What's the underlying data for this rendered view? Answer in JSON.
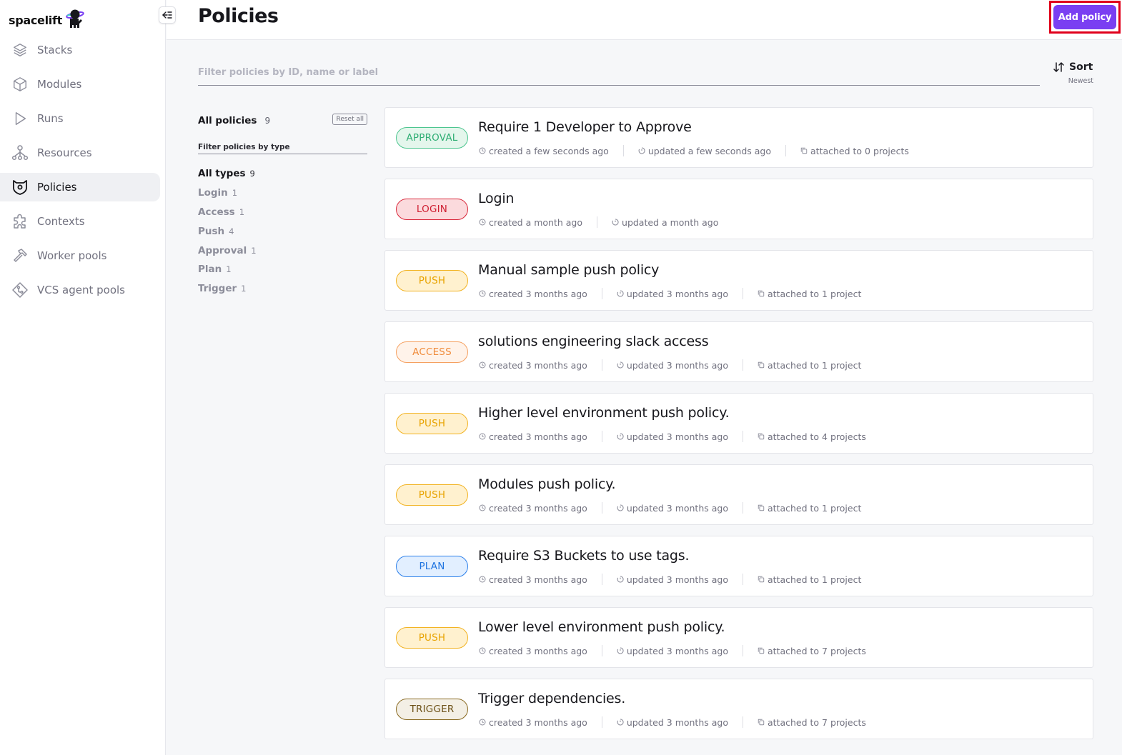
{
  "app": {
    "brand": "spacelift"
  },
  "sidebar": {
    "items": [
      {
        "label": "Stacks",
        "icon": "layers-icon",
        "active": false
      },
      {
        "label": "Modules",
        "icon": "cube-icon",
        "active": false
      },
      {
        "label": "Runs",
        "icon": "play-icon",
        "active": false
      },
      {
        "label": "Resources",
        "icon": "hierarchy-icon",
        "active": false
      },
      {
        "label": "Policies",
        "icon": "shield-devil-icon",
        "active": true
      },
      {
        "label": "Contexts",
        "icon": "puzzle-icon",
        "active": false
      },
      {
        "label": "Worker pools",
        "icon": "hammer-icon",
        "active": false
      },
      {
        "label": "VCS agent pools",
        "icon": "git-diamond-icon",
        "active": false
      }
    ]
  },
  "header": {
    "title": "Policies",
    "add_button": "Add policy"
  },
  "search": {
    "placeholder": "Filter policies by ID, name or label",
    "value": ""
  },
  "sort": {
    "label": "Sort",
    "value": "Newest"
  },
  "filters": {
    "all_policies_label": "All policies",
    "all_policies_count": "9",
    "reset_label": "Reset all",
    "type_header": "Filter policies by type",
    "types": [
      {
        "label": "All types",
        "count": "9",
        "active": true
      },
      {
        "label": "Login",
        "count": "1",
        "active": false
      },
      {
        "label": "Access",
        "count": "1",
        "active": false
      },
      {
        "label": "Push",
        "count": "4",
        "active": false
      },
      {
        "label": "Approval",
        "count": "1",
        "active": false
      },
      {
        "label": "Plan",
        "count": "1",
        "active": false
      },
      {
        "label": "Trigger",
        "count": "1",
        "active": false
      }
    ]
  },
  "badge_colors": {
    "APPROVAL": {
      "text": "#2fae74",
      "border": "#4cc58f",
      "bg": "#e4f6ec"
    },
    "LOGIN": {
      "text": "#cf1f32",
      "border": "#d9293c",
      "bg": "#fbdadd"
    },
    "PUSH": {
      "text": "#e8a300",
      "border": "#f2b322",
      "bg": "#fff1cf"
    },
    "ACCESS": {
      "text": "#f08c3c",
      "border": "#f5a060",
      "bg": "#fff3ea"
    },
    "PLAN": {
      "text": "#1f74e0",
      "border": "#2d80ea",
      "bg": "#e2efff"
    },
    "TRIGGER": {
      "text": "#6b5016",
      "border": "#8a6a22",
      "bg": "#f3efe5"
    }
  },
  "policies": [
    {
      "type": "APPROVAL",
      "name": "Require 1 Developer to Approve",
      "created": "created a few seconds ago",
      "updated": "updated a few seconds ago",
      "attached": "attached to 0 projects"
    },
    {
      "type": "LOGIN",
      "name": "Login",
      "created": "created a month ago",
      "updated": "updated a month ago",
      "attached": null
    },
    {
      "type": "PUSH",
      "name": "Manual sample push policy",
      "created": "created 3 months ago",
      "updated": "updated 3 months ago",
      "attached": "attached to 1 project"
    },
    {
      "type": "ACCESS",
      "name": "solutions engineering slack access",
      "created": "created 3 months ago",
      "updated": "updated 3 months ago",
      "attached": "attached to 1 project"
    },
    {
      "type": "PUSH",
      "name": "Higher level environment push policy.",
      "created": "created 3 months ago",
      "updated": "updated 3 months ago",
      "attached": "attached to 4 projects"
    },
    {
      "type": "PUSH",
      "name": "Modules push policy.",
      "created": "created 3 months ago",
      "updated": "updated 3 months ago",
      "attached": "attached to 1 project"
    },
    {
      "type": "PLAN",
      "name": "Require S3 Buckets to use tags.",
      "created": "created 3 months ago",
      "updated": "updated 3 months ago",
      "attached": "attached to 1 project"
    },
    {
      "type": "PUSH",
      "name": "Lower level environment push policy.",
      "created": "created 3 months ago",
      "updated": "updated 3 months ago",
      "attached": "attached to 7 projects"
    },
    {
      "type": "TRIGGER",
      "name": "Trigger dependencies.",
      "created": "created 3 months ago",
      "updated": "updated 3 months ago",
      "attached": "attached to 7 projects"
    }
  ]
}
